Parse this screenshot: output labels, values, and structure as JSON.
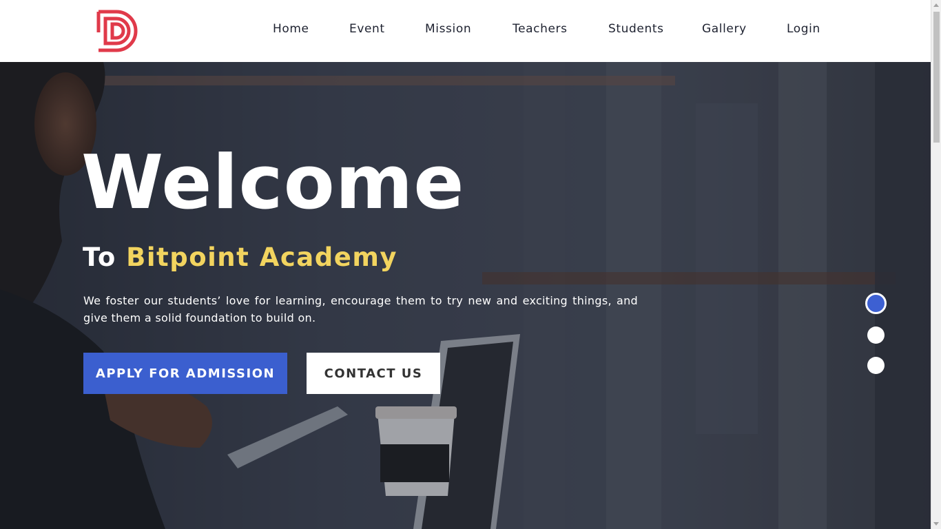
{
  "brand": {
    "logo_icon": "bitpoint-d-logo-icon",
    "logo_color": "#e03a4a"
  },
  "nav": {
    "items": [
      {
        "label": "Home"
      },
      {
        "label": "Event"
      },
      {
        "label": "Mission"
      },
      {
        "label": "Teachers"
      },
      {
        "label": "Students"
      },
      {
        "label": "Gallery"
      },
      {
        "label": "Login"
      }
    ]
  },
  "hero": {
    "title": "Welcome",
    "subtitle_prefix": "To",
    "subtitle_brand": "Bitpoint Academy",
    "description": "We foster our students’ love for learning, encourage them to try new and exciting things, and give them a solid foundation to build on.",
    "apply_label": "APPLY FOR ADMISSION",
    "contact_label": "CONTACT US",
    "accent_color": "#3b5fcf",
    "brand_text_color": "#f2d45f"
  },
  "slider": {
    "slides": 3,
    "active_slide": 1
  }
}
